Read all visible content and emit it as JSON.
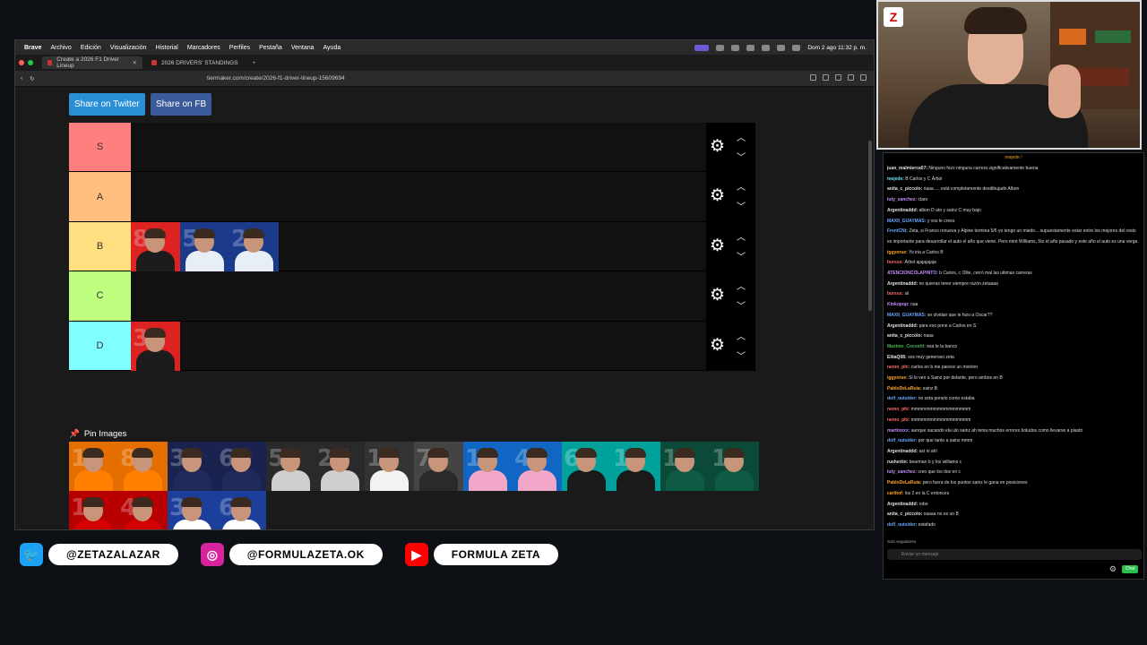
{
  "menubar": {
    "items": [
      "Brave",
      "Archivo",
      "Edición",
      "Visualización",
      "Historial",
      "Marcadores",
      "Perfiles",
      "Pestaña",
      "Ventana",
      "Ayuda"
    ],
    "datetime": "Dom 2 ago 11:32 p. m."
  },
  "tabs": [
    {
      "label": "Create a 2026 F1 Driver Lineup"
    },
    {
      "label": "2026 DRIVERS' STANDINGS"
    }
  ],
  "url": "tiermaker.com/create/2026-f1-driver-lineup-15609694",
  "share": {
    "twitter": "Share on Twitter",
    "fb": "Share on FB"
  },
  "tiers": [
    {
      "label": "S",
      "color": "#ff7f7f",
      "drivers": []
    },
    {
      "label": "A",
      "color": "#ffbf7f",
      "drivers": []
    },
    {
      "label": "B",
      "color": "#ffdf7f",
      "drivers": [
        {
          "num": "87",
          "team": "haas",
          "body": "#1c1c1c",
          "accent": "#d22"
        },
        {
          "num": "55",
          "team": "williams",
          "body": "#e8eef6",
          "accent": "#1b3a8c"
        },
        {
          "num": "23",
          "team": "williams",
          "body": "#e8eef6",
          "accent": "#1b3a8c"
        }
      ]
    },
    {
      "label": "C",
      "color": "#bfff7f",
      "drivers": []
    },
    {
      "label": "D",
      "color": "#7fffff",
      "drivers": [
        {
          "num": "31",
          "team": "haas",
          "body": "#1c1c1c",
          "accent": "#d22"
        }
      ]
    }
  ],
  "pin_label": "Pin Images",
  "pool": [
    {
      "num": "1",
      "body": "#ff8000",
      "bg": "#e56e00"
    },
    {
      "num": "81",
      "body": "#ff8000",
      "bg": "#e56e00"
    },
    {
      "num": "3",
      "body": "#1e2a5a",
      "bg": "#1a2350"
    },
    {
      "num": "6",
      "body": "#1e2a5a",
      "bg": "#1a2350"
    },
    {
      "num": "5",
      "body": "#cfcfcf",
      "bg": "#2a2a2a"
    },
    {
      "num": "27",
      "body": "#cfcfcf",
      "bg": "#2a2a2a"
    },
    {
      "num": "11",
      "body": "#f2f2f2",
      "bg": "#333"
    },
    {
      "num": "77",
      "body": "#2a2a2a",
      "bg": "#444"
    },
    {
      "num": "10",
      "body": "#f2a7c8",
      "bg": "#1066c2"
    },
    {
      "num": "43",
      "body": "#f2a7c8",
      "bg": "#1066c2"
    },
    {
      "num": "63",
      "body": "#1a1a1a",
      "bg": "#00a19b"
    },
    {
      "num": "12",
      "body": "#1a1a1a",
      "bg": "#00a19b"
    },
    {
      "num": "14",
      "body": "#0f5b45",
      "bg": "#0b4a38"
    },
    {
      "num": "18",
      "body": "#0f5b45",
      "bg": "#0b4a38"
    },
    {
      "num": "16",
      "body": "#d40000",
      "bg": "#b80000"
    },
    {
      "num": "44",
      "body": "#d40000",
      "bg": "#b80000"
    },
    {
      "num": "30",
      "body": "#ffffff",
      "bg": "#1d3f9c"
    },
    {
      "num": "6",
      "body": "#ffffff",
      "bg": "#1d3f9c"
    }
  ],
  "chat": {
    "header": "mejede !",
    "messages": [
      {
        "user": "juan_malmierca07:",
        "color": "#e0e0e0",
        "text": "Ninguno hizo ninguna carrera significativamente buena"
      },
      {
        "user": "mejede:",
        "color": "#6fe3ff",
        "text": "B Carlos y C Árbol"
      },
      {
        "user": "anita_c_piccolo:",
        "color": "#e0e0e0",
        "text": "naaa..... está completamente desdibujado Albon"
      },
      {
        "user": "luty_sanchez:",
        "color": "#c88cff",
        "text": "claro"
      },
      {
        "user": "Argentinaddd:",
        "color": "#e0e0e0",
        "text": "albon D ato y sainz C muy bajo"
      },
      {
        "user": "MAXII_GUAYMAS:",
        "color": "#6aa8ff",
        "text": "y vos le crees"
      },
      {
        "user": "FrentCNt:",
        "color": "#6aa8ff",
        "text": "Zeta, si Franco renueva y Alpine termina 5/6 yo tengo un miedo... supuestamente estar entre los mejores del resto es importante para desarrollar el auto el año que viene. Pero miré Williams, 5to el año pasado y este año el auto es una verga"
      },
      {
        "user": "iggyorue:",
        "color": "#ffa726",
        "text": "Yo iria a Carlos B"
      },
      {
        "user": "bursss:",
        "color": "#ff6b6b",
        "text": "Árbol ajajajajaja"
      },
      {
        "user": "ATENCIONCOLAPINTO:",
        "color": "#c88cff",
        "text": "b Carlos, c Ollie, cerró mal las ultimas carreras"
      },
      {
        "user": "Argentinaddd:",
        "color": "#e0e0e0",
        "text": "no quieras tener siempre razón zetaaaa"
      },
      {
        "user": "bursss:",
        "color": "#ff6b6b",
        "text": "sii"
      },
      {
        "user": "Kinkopop:",
        "color": "#c88cff",
        "text": "naa"
      },
      {
        "user": "MAXII_GUAYMAS:",
        "color": "#6aa8ff",
        "text": "se olvidan que le hizo a Oscar??"
      },
      {
        "user": "Argentinaddd:",
        "color": "#e0e0e0",
        "text": "para eso pone a Carlos en S"
      },
      {
        "user": "anita_c_piccolo:",
        "color": "#e0e0e0",
        "text": "naaa"
      },
      {
        "user": "Maximo_Cossetti:",
        "color": "#4caf50",
        "text": "esa te la banco"
      },
      {
        "user": "ElitaQ08:",
        "color": "#e0e0e0",
        "text": "sos muy generoso zeta"
      },
      {
        "user": "nemo_phi:",
        "color": "#ff6b6b",
        "text": "carlos en b me parece un monton"
      },
      {
        "user": "iggyorue:",
        "color": "#ffa726",
        "text": "Si lo veo a Sainz por delante, pero ambos en B"
      },
      {
        "user": "PabloDeLaRuia:",
        "color": "#ffa726",
        "text": "sainz B"
      },
      {
        "user": "dolf_outsider:",
        "color": "#6aa8ff",
        "text": "no zeta ponelo como estaba"
      },
      {
        "user": "nemo_phi:",
        "color": "#ff6b6b",
        "text": "mmmmmmmmmmmmmmmm"
      },
      {
        "user": "nemo_phi:",
        "color": "#ff6b6b",
        "text": "mmmmmmmmmmmmmmmm"
      },
      {
        "user": "martinxxx:",
        "color": "#c88cff",
        "text": "aunque sacando ela ulo sainz ah tenia muchos errores boludos como llevarse a piastri"
      },
      {
        "user": "dolf_outsider:",
        "color": "#6aa8ff",
        "text": "por que tanto a sainz mmm"
      },
      {
        "user": "Argentinaddd:",
        "color": "#e0e0e0",
        "text": "así ni ahí"
      },
      {
        "user": "rushertin:",
        "color": "#e0e0e0",
        "text": "bearman b y los williams c"
      },
      {
        "user": "luty_sanchez:",
        "color": "#c88cff",
        "text": "creo que los dos en c"
      },
      {
        "user": "PabloDeLaRuia:",
        "color": "#ffa726",
        "text": "pero fuera de los puntos sainz le gana en posiciones"
      },
      {
        "user": "carlitof:",
        "color": "#ffa726",
        "text": "los 2 en la C entonces"
      },
      {
        "user": "Argentinaddd:",
        "color": "#e0e0e0",
        "text": "robo"
      },
      {
        "user": "anita_c_piccolo:",
        "color": "#e0e0e0",
        "text": "naaaa no es un B"
      },
      {
        "user": "dolf_outsider:",
        "color": "#6aa8ff",
        "text": "estafado"
      }
    ],
    "follow_note": "Solo seguidores",
    "input_placeholder": "Enviar un mensaje",
    "send_label": "Chat"
  },
  "socials": [
    {
      "icon": "twitter-icon",
      "handle": "@ZETAZALAZAR",
      "color": "#1da1f2"
    },
    {
      "icon": "instagram-icon",
      "handle": "@FORMULAZETA.OK",
      "color": "#d6249f"
    },
    {
      "icon": "youtube-icon",
      "handle": "FORMULA ZETA",
      "color": "#ff0000"
    }
  ]
}
